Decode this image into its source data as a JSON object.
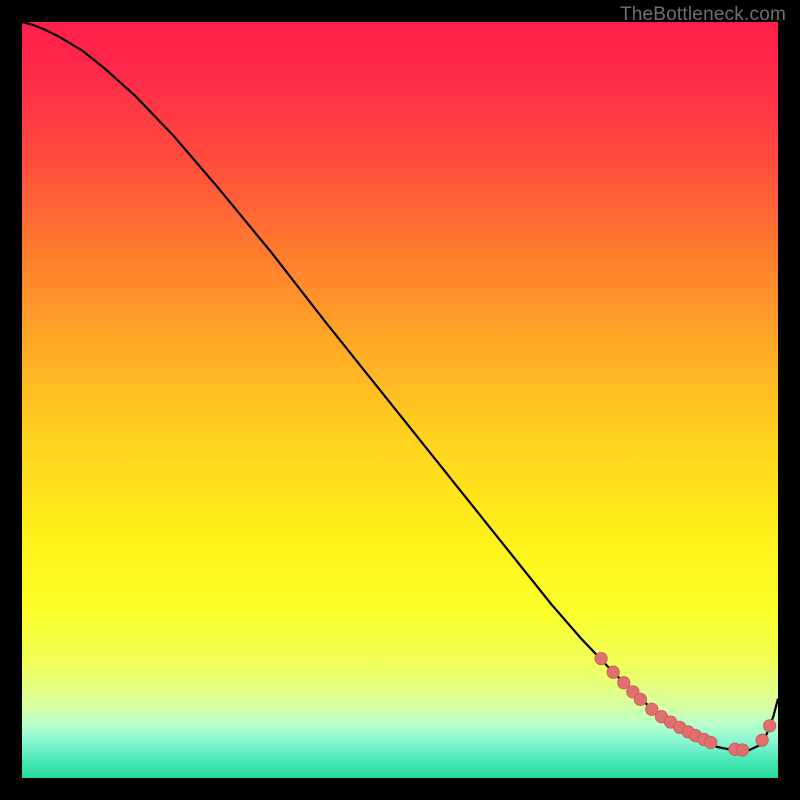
{
  "attribution": "TheBottleneck.com",
  "colors": {
    "bg_black": "#000000",
    "curve_stroke": "#000000",
    "marker_fill": "#e0706e",
    "marker_stroke": "#c95a58",
    "attribution_text": "#6f6f6f"
  },
  "gradient_stops": [
    {
      "offset": 0.0,
      "color": "#ff1e4c"
    },
    {
      "offset": 0.07,
      "color": "#ff2a49"
    },
    {
      "offset": 0.18,
      "color": "#ff4b3d"
    },
    {
      "offset": 0.3,
      "color": "#ff7a2f"
    },
    {
      "offset": 0.42,
      "color": "#ffa726"
    },
    {
      "offset": 0.55,
      "color": "#ffd21f"
    },
    {
      "offset": 0.68,
      "color": "#fff01a"
    },
    {
      "offset": 0.78,
      "color": "#fbff2a"
    },
    {
      "offset": 0.85,
      "color": "#f0ff5a"
    },
    {
      "offset": 0.905,
      "color": "#d8ffa3"
    },
    {
      "offset": 0.93,
      "color": "#b6ffce"
    },
    {
      "offset": 0.955,
      "color": "#80f5d0"
    },
    {
      "offset": 0.975,
      "color": "#4de8b8"
    },
    {
      "offset": 1.0,
      "color": "#24dd9a"
    }
  ],
  "chart_data": {
    "type": "line",
    "title": "",
    "xlabel": "",
    "ylabel": "",
    "x_range": [
      0,
      100
    ],
    "y_range": [
      0,
      100
    ],
    "series": [
      {
        "name": "curve",
        "x": [
          0,
          1.5,
          3,
          5,
          8,
          11,
          15,
          20,
          26,
          33,
          40,
          48,
          56,
          64,
          70,
          74,
          78,
          81,
          83.5,
          86,
          88,
          90,
          92,
          94,
          96,
          97.5,
          98.5,
          99.4,
          100
        ],
        "y": [
          100,
          99.6,
          99.0,
          98.0,
          96.2,
          93.8,
          90.2,
          85.0,
          78.0,
          69.5,
          60.5,
          50.5,
          40.5,
          30.5,
          23.0,
          18.4,
          14.2,
          11.2,
          9.0,
          7.2,
          5.8,
          4.8,
          4.1,
          3.7,
          3.6,
          4.3,
          5.8,
          8.2,
          10.5
        ]
      },
      {
        "name": "markers-bottom",
        "x": [
          76.6,
          78.2,
          79.6,
          80.8,
          81.8,
          83.3,
          84.6,
          85.8,
          87.0,
          88.1,
          89.1,
          90.2,
          91.1,
          94.3,
          95.3
        ],
        "y": [
          15.8,
          14.0,
          12.6,
          11.4,
          10.4,
          9.1,
          8.1,
          7.4,
          6.7,
          6.1,
          5.6,
          5.1,
          4.7,
          3.8,
          3.7
        ]
      },
      {
        "name": "markers-right",
        "x": [
          97.9,
          98.9
        ],
        "y": [
          5.0,
          6.9
        ]
      }
    ]
  }
}
